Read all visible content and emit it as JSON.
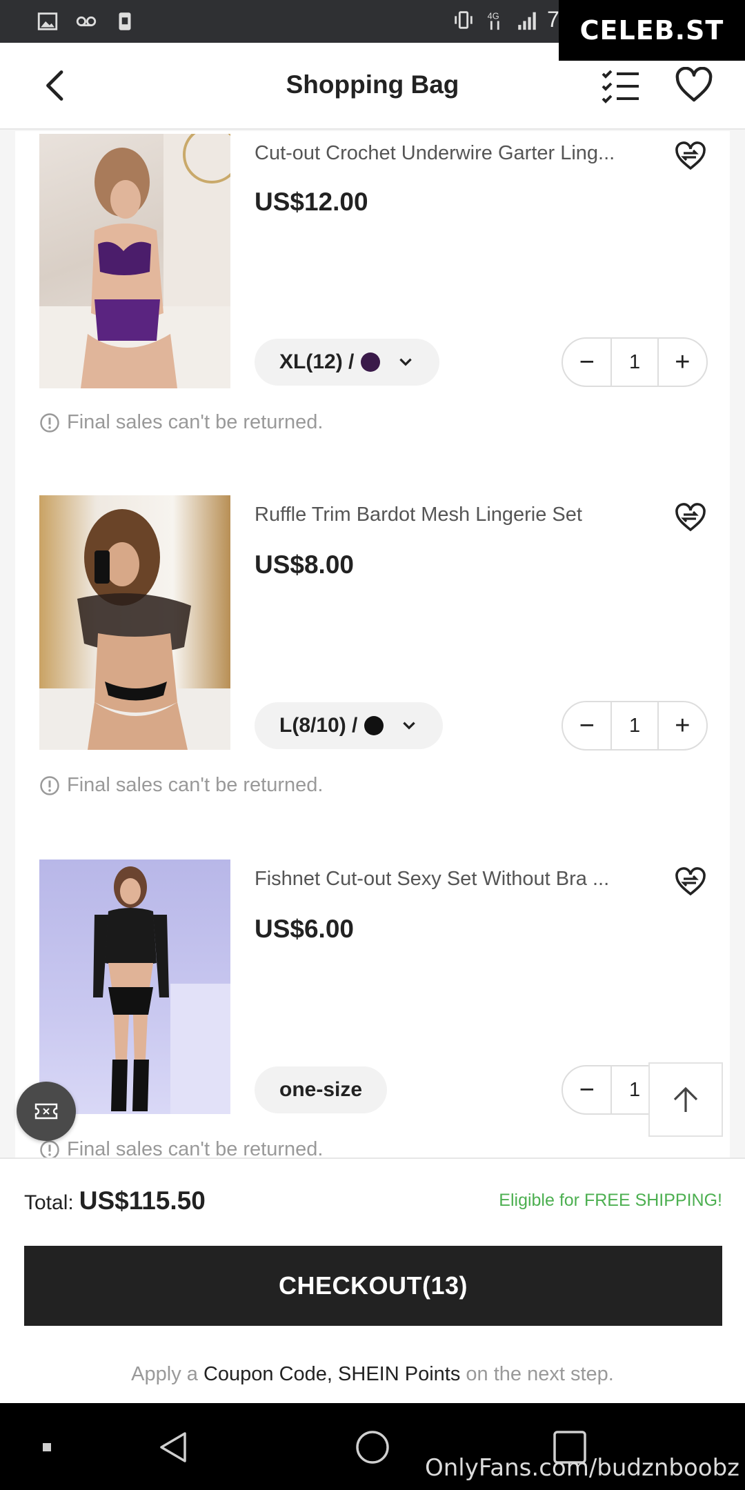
{
  "watermarks": {
    "top": "CELEB.ST",
    "bottom": "OnlyFans.com/budznboobz"
  },
  "status_bar": {
    "partial_text": "79"
  },
  "header": {
    "title": "Shopping Bag"
  },
  "items": [
    {
      "title": "Cut-out Crochet Underwire Garter Ling...",
      "price": "US$12.00",
      "attr_label": "XL(12) /",
      "swatch_color": "#3a1a4a",
      "has_dropdown": true,
      "quantity": "1",
      "notice": "Final sales can't be returned."
    },
    {
      "title": "Ruffle Trim Bardot Mesh Lingerie Set",
      "price": "US$8.00",
      "attr_label": "L(8/10) /",
      "swatch_color": "#111111",
      "has_dropdown": true,
      "quantity": "1",
      "notice": "Final sales can't be returned."
    },
    {
      "title": "Fishnet Cut-out Sexy Set Without Bra ...",
      "price": "US$6.00",
      "attr_label": "one-size",
      "has_dropdown": false,
      "quantity": "1",
      "notice": "Final sales can't be returned."
    }
  ],
  "footer": {
    "total_label": "Total:",
    "total_amount": "US$115.50",
    "shipping_note": "Eligible for FREE SHIPPING!",
    "checkout_label": "CHECKOUT(13)",
    "apply_prefix": "Apply a",
    "apply_highlight": "Coupon Code, SHEIN Points",
    "apply_suffix": "on the next step."
  },
  "colors": {
    "accent_green": "#4caf50",
    "checkout_bg": "#222222"
  }
}
